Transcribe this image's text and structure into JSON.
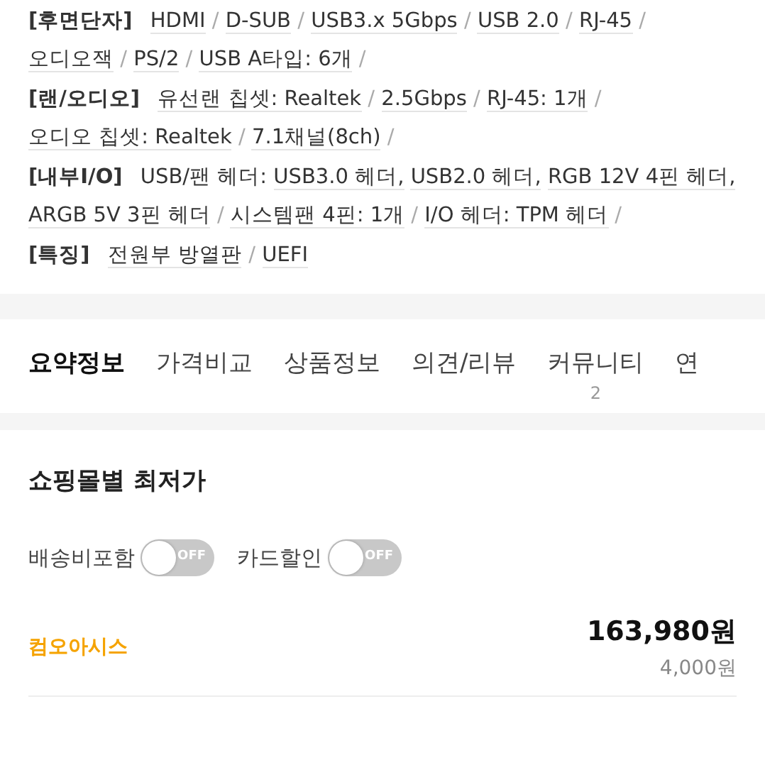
{
  "specs": [
    {
      "label": "[후면단자]",
      "items": [
        {
          "kind": "link",
          "text": "HDMI"
        },
        {
          "kind": "sep",
          "text": "/"
        },
        {
          "kind": "link",
          "text": "D-SUB"
        },
        {
          "kind": "sep",
          "text": "/"
        },
        {
          "kind": "link",
          "text": "USB3.x 5Gbps"
        },
        {
          "kind": "sep",
          "text": "/"
        },
        {
          "kind": "link",
          "text": "USB 2.0"
        },
        {
          "kind": "sep",
          "text": "/"
        },
        {
          "kind": "link",
          "text": "RJ-45"
        },
        {
          "kind": "sep",
          "text": "/"
        },
        {
          "kind": "link",
          "text": "오디오잭"
        },
        {
          "kind": "sep",
          "text": "/"
        },
        {
          "kind": "link",
          "text": "PS/2"
        },
        {
          "kind": "sep",
          "text": "/"
        },
        {
          "kind": "link",
          "text": "USB A타입: 6개"
        },
        {
          "kind": "sep",
          "text": "/"
        }
      ]
    },
    {
      "label": "[랜/오디오]",
      "items": [
        {
          "kind": "link",
          "text": "유선랜 칩셋: Realtek"
        },
        {
          "kind": "sep",
          "text": "/"
        },
        {
          "kind": "link",
          "text": "2.5Gbps"
        },
        {
          "kind": "sep",
          "text": "/"
        },
        {
          "kind": "link",
          "text": "RJ-45: 1개"
        },
        {
          "kind": "sep",
          "text": "/"
        },
        {
          "kind": "link",
          "text": "오디오 칩셋: Realtek"
        },
        {
          "kind": "sep",
          "text": "/"
        },
        {
          "kind": "link",
          "text": "7.1채널(8ch)"
        },
        {
          "kind": "sep",
          "text": "/"
        }
      ]
    },
    {
      "label": "[내부I/O]",
      "items": [
        {
          "kind": "plain",
          "text": "USB/팬 헤더:"
        },
        {
          "kind": "link",
          "text": "USB3.0 헤더,"
        },
        {
          "kind": "link",
          "text": "USB2.0 헤더,"
        },
        {
          "kind": "link",
          "text": "RGB 12V 4핀 헤더,"
        },
        {
          "kind": "link",
          "text": "ARGB 5V 3핀 헤더"
        },
        {
          "kind": "sep",
          "text": "/"
        },
        {
          "kind": "link",
          "text": "시스템팬 4핀: 1개"
        },
        {
          "kind": "sep",
          "text": "/"
        },
        {
          "kind": "link",
          "text": "I/O 헤더: TPM 헤더"
        },
        {
          "kind": "sep",
          "text": "/"
        }
      ]
    },
    {
      "label": "[특징]",
      "items": [
        {
          "kind": "link",
          "text": "전원부 방열판"
        },
        {
          "kind": "sep",
          "text": "/"
        },
        {
          "kind": "link",
          "text": "UEFI"
        }
      ]
    }
  ],
  "tabs": [
    {
      "label": "요약정보",
      "selected": true
    },
    {
      "label": "가격비교",
      "selected": false
    },
    {
      "label": "상품정보",
      "selected": false
    },
    {
      "label": "의견/리뷰",
      "selected": false
    },
    {
      "label": "커뮤니티",
      "selected": false,
      "count": "2"
    },
    {
      "label": "연",
      "selected": false
    }
  ],
  "lowest_price": {
    "title": "쇼핑몰별 최저가",
    "toggles": [
      {
        "label": "배송비포함",
        "on": false,
        "state_text": "OFF"
      },
      {
        "label": "카드할인",
        "on": false,
        "state_text": "OFF"
      }
    ],
    "shops": [
      {
        "name": "컴오아시스",
        "price": "163,980원",
        "shipping": "4,000원"
      }
    ]
  }
}
